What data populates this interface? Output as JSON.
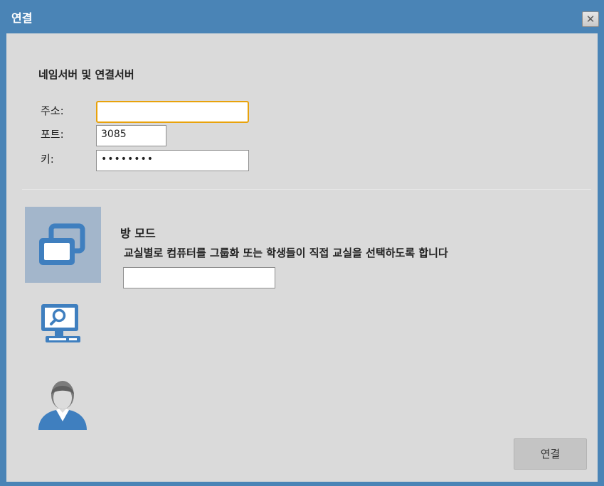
{
  "window": {
    "title": "연결",
    "close_icon": "close-icon"
  },
  "server": {
    "section_title": "네임서버 및 연결서버",
    "address_label": "주소:",
    "address_value": "",
    "port_label": "포트:",
    "port_value": "3085",
    "key_label": "키:",
    "key_value": "••••••••"
  },
  "modes": {
    "icons": [
      "room-mode-icon",
      "monitor-search-icon",
      "user-icon"
    ],
    "selected": "room-mode-icon",
    "title": "방 모드",
    "description": "교실별로 컴퓨터를 그룹화 또는 학생들이 직접 교실을 선택하도록 합니다",
    "room_input_value": ""
  },
  "footer": {
    "connect_label": "연결"
  },
  "colors": {
    "titlebar": "#4a84b6",
    "panel": "#dadada",
    "icon_blue": "#3f7fbf",
    "selected_bg": "#a3b6cb",
    "focus_border": "#e8a20c"
  }
}
